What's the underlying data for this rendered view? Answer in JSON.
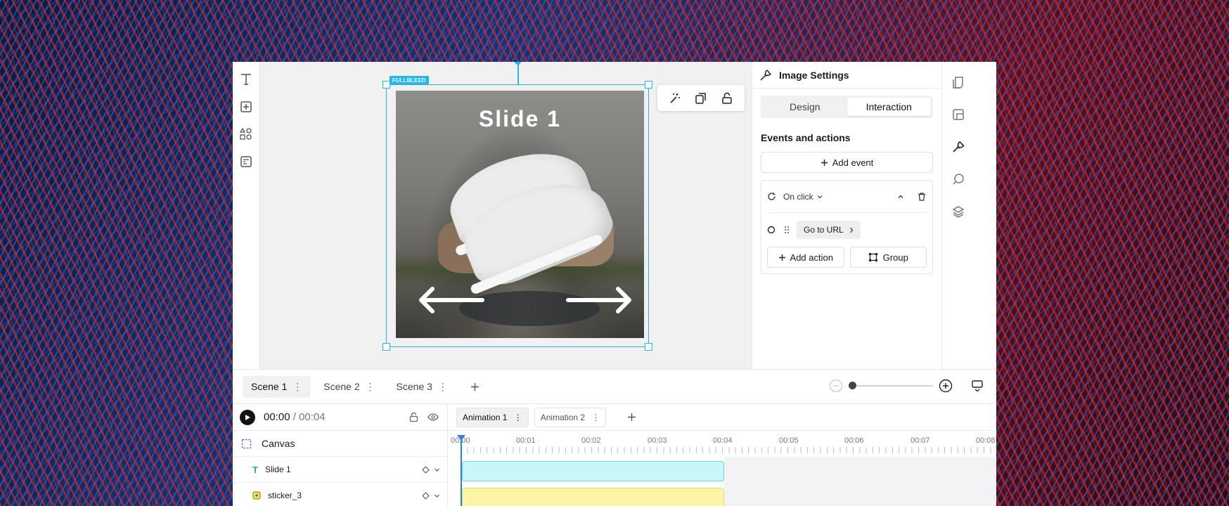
{
  "canvas": {
    "badge": "FULLBLEED",
    "slide_title": "Slide 1"
  },
  "panel": {
    "title": "Image Settings",
    "tabs": [
      "Design",
      "Interaction"
    ],
    "active_tab": "Interaction",
    "section_title": "Events and actions",
    "add_event": "Add event",
    "event": {
      "trigger": "On click",
      "action": "Go to URL",
      "add_action": "Add action",
      "group": "Group"
    }
  },
  "scenes": [
    "Scene 1",
    "Scene 2",
    "Scene 3"
  ],
  "timeline": {
    "current": "00:00",
    "separator": " / ",
    "duration": "00:04",
    "layers": [
      "Canvas",
      "Slide 1",
      "sticker_3"
    ],
    "animations": [
      "Animation 1",
      "Animation 2"
    ],
    "ticks": [
      "00:00",
      "00:01",
      "00:02",
      "00:03",
      "00:04",
      "00:05",
      "00:06",
      "00:07",
      "00:08"
    ]
  },
  "colors": {
    "selection": "#22b8ef",
    "playhead": "#2f7de6",
    "track_text": "#c8f7fa",
    "track_sticker": "#fbf5a6"
  },
  "icons": {
    "left_toolbar": [
      "text-icon",
      "add-media-icon",
      "shapes-icon",
      "template-icon"
    ],
    "right_rail": [
      "pages-icon",
      "layout-icon",
      "wrench-icon",
      "shape-edit-icon",
      "layers-icon"
    ],
    "floating_toolbar": [
      "magic-wand-icon",
      "duplicate-icon",
      "unlock-icon"
    ]
  }
}
